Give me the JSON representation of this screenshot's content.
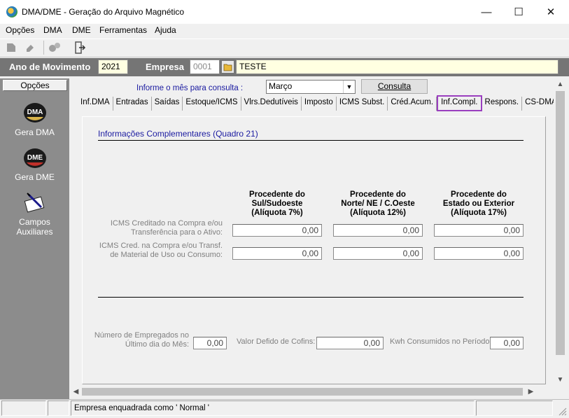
{
  "window": {
    "title": "DMA/DME - Geração do Arquivo Magnético",
    "minimize": "—",
    "maximize": "☐",
    "close": "✕"
  },
  "menu": [
    "Opções",
    "DMA",
    "DME",
    "Ferramentas",
    "Ajuda"
  ],
  "header": {
    "ano_label": "Ano de Movimento",
    "ano_value": "2021",
    "empresa_label": "Empresa",
    "empresa_code": "0001",
    "empresa_name": "TESTE"
  },
  "options": {
    "header": "Opções",
    "items": [
      {
        "label": "Gera DMA",
        "icon": "dma-icon",
        "badge": "DMA"
      },
      {
        "label": "Gera DME",
        "icon": "dme-icon",
        "badge": "DME"
      },
      {
        "label": "Campos Auxiliares",
        "icon": "auxiliary-fields-icon"
      }
    ]
  },
  "query": {
    "hint": "Informe o mês para consulta :",
    "month": "Março",
    "button": "Consulta"
  },
  "tabs": [
    "Inf.DMA",
    "Entradas",
    "Saídas",
    "Estoque/ICMS",
    "Vlrs.Dedutíveis",
    "Imposto",
    "ICMS Subst.",
    "Créd.Acum.",
    "Inf.Compl.",
    "Respons.",
    "CS-DMA"
  ],
  "active_tab": "Inf.Compl.",
  "content": {
    "section_title": "Informações Complementares (Quadro 21)",
    "columns": [
      [
        "Procedente do",
        "Sul/Sudoeste",
        "(Alíquota 7%)"
      ],
      [
        "Procedente do",
        "Norte/ NE / C.Oeste",
        "(Alíquota 12%)"
      ],
      [
        "Procedente do",
        "Estado ou Exterior",
        "(Alíquota 17%)"
      ]
    ],
    "rows": [
      {
        "label1": "ICMS Creditado na Compra e/ou",
        "label2": "Transferência para o Ativo:",
        "values": [
          "0,00",
          "0,00",
          "0,00"
        ]
      },
      {
        "label1": "ICMS Cred. na Compra e/ou Transf.",
        "label2": "de Material de Uso ou Consumo:",
        "values": [
          "0,00",
          "0,00",
          "0,00"
        ]
      }
    ],
    "employees_label1": "Número de Empregados no",
    "employees_label2": "Último dia do Mês:",
    "employees_value": "0,00",
    "cofins_label": "Valor Defido de Cofins:",
    "cofins_value": "0,00",
    "kwh_label": "Kwh Consumidos no Período:",
    "kwh_value": "0,00"
  },
  "status": {
    "text": "Empresa enquadrada como ' Normal '"
  }
}
